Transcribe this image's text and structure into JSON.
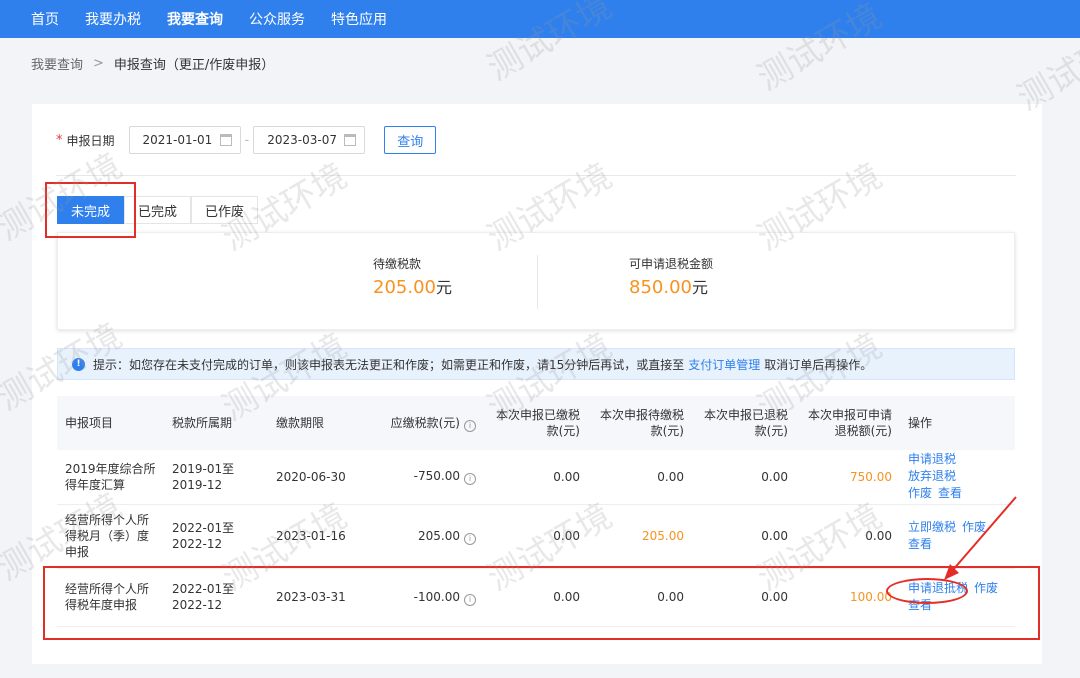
{
  "nav": {
    "items": [
      "首页",
      "我要办税",
      "我要查询",
      "公众服务",
      "特色应用"
    ],
    "active_index": 2
  },
  "breadcrumb": {
    "root": "我要查询",
    "separator": ">",
    "current": "申报查询（更正/作废申报）"
  },
  "filter": {
    "required_mark": "*",
    "label": "申报日期",
    "start_date": "2021-01-01",
    "range_separator": "-",
    "end_date": "2023-03-07",
    "query_label": "查询"
  },
  "tabs": [
    "未完成",
    "已完成",
    "已作废"
  ],
  "summary": {
    "pending_label": "待缴税款",
    "pending_amount": "205.00",
    "pending_unit": "元",
    "refund_label": "可申请退税金额",
    "refund_amount": "850.00",
    "refund_unit": "元"
  },
  "notice": {
    "prefix": "提示：如您存在未支付完成的订单，则该申报表无法更正和作废；如需更正和作废，请15分钟后再试，或直接至",
    "link": "支付订单管理",
    "suffix": "取消订单后再操作。"
  },
  "table": {
    "headers": [
      "申报项目",
      "税款所属期",
      "缴款期限",
      "应缴税款(元)",
      "本次申报已缴税款(元)",
      "本次申报待缴税款(元)",
      "本次申报已退税款(元)",
      "本次申报可申请退税额(元)",
      "操作"
    ],
    "rows": [
      {
        "item": "2019年度综合所得年度汇算",
        "period": "2019-01至2019-12",
        "deadline": "2020-06-30",
        "payable": "-750.00",
        "paid": "0.00",
        "pending": "0.00",
        "refunded": "0.00",
        "refundable": "750.00",
        "ops": [
          "申请退税",
          "放弃退税",
          "作废",
          "查看"
        ]
      },
      {
        "item": "经营所得个人所得税月（季）度申报",
        "period": "2022-01至2022-12",
        "deadline": "2023-01-16",
        "payable": "205.00",
        "paid": "0.00",
        "pending": "205.00",
        "refunded": "0.00",
        "refundable": "0.00",
        "ops": [
          "立即缴税",
          "作废",
          "查看"
        ]
      },
      {
        "item": "经营所得个人所得税年度申报",
        "period": "2022-01至2022-12",
        "deadline": "2023-03-31",
        "payable": "-100.00",
        "paid": "0.00",
        "pending": "0.00",
        "refunded": "0.00",
        "refundable": "100.00",
        "ops": [
          "申请退抵税",
          "作废",
          "查看"
        ]
      }
    ]
  },
  "watermark": "测试环境",
  "colors": {
    "nav_bg": "#2f80ed",
    "accent": "#2f80ed",
    "amount": "#f7931e",
    "annotation": "#e52d27"
  }
}
